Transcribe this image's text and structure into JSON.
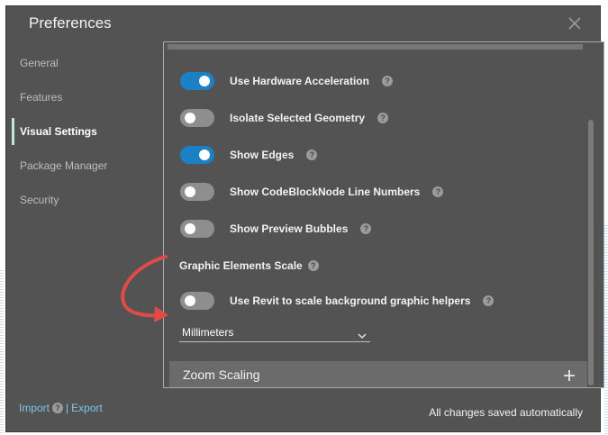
{
  "dialog": {
    "title": "Preferences"
  },
  "sidebar": {
    "items": [
      {
        "label": "General",
        "active": false
      },
      {
        "label": "Features",
        "active": false
      },
      {
        "label": "Visual Settings",
        "active": true
      },
      {
        "label": "Package Manager",
        "active": false
      },
      {
        "label": "Security",
        "active": false
      }
    ]
  },
  "settings": [
    {
      "label": "Use Hardware Acceleration",
      "on": true
    },
    {
      "label": "Isolate Selected Geometry",
      "on": false
    },
    {
      "label": "Show Edges",
      "on": true
    },
    {
      "label": "Show CodeBlockNode Line Numbers",
      "on": false
    },
    {
      "label": "Show Preview Bubbles",
      "on": false
    }
  ],
  "graphic_scale": {
    "section_label": "Graphic Elements Scale",
    "revit_toggle_label": "Use Revit to scale background graphic helpers",
    "revit_toggle_on": false,
    "units_value": "Millimeters"
  },
  "zoom": {
    "title": "Zoom Scaling"
  },
  "footer": {
    "import_label": "Import",
    "separator": "|",
    "export_label": "Export",
    "status": "All changes saved automatically"
  },
  "icons": {
    "help": "?",
    "help_icon_name": "question-circle-icon",
    "close_icon_name": "close-icon",
    "chevron_icon_name": "chevron-down-icon",
    "plus_icon_name": "plus-icon"
  },
  "colors": {
    "dialog_bg": "#535353",
    "toggle_on": "#1b80c4",
    "toggle_off": "#8e8e8e",
    "link": "#7ec3ee",
    "active_indicator": "#bfe6da",
    "annotation_arrow": "#e24a4a"
  }
}
